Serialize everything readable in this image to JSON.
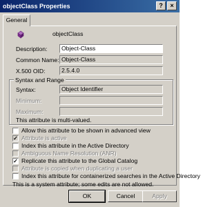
{
  "window": {
    "title": "objectClass Properties",
    "help_button": "?",
    "close_button": "×"
  },
  "tabs": [
    {
      "label": "General"
    }
  ],
  "header": {
    "object_name": "objectClass"
  },
  "fields": {
    "description": {
      "label": "Description:",
      "value": "Object-Class"
    },
    "common_name": {
      "label": "Common Name:",
      "value": "Object-Class"
    },
    "x500_oid": {
      "label": "X.500 OID:",
      "value": "2.5.4.0"
    }
  },
  "syntax_group": {
    "title": "Syntax and Range",
    "syntax": {
      "label": "Syntax:",
      "value": "Object Identifier"
    },
    "minimum": {
      "label": "Minimum:",
      "value": ""
    },
    "maximum": {
      "label": "Maximum:",
      "value": ""
    },
    "note": "This attribute is multi-valued."
  },
  "checkboxes": [
    {
      "label": "Allow this attribute to be shown in advanced view",
      "checked": false,
      "enabled": true
    },
    {
      "label": "Attribute is active",
      "checked": true,
      "enabled": false
    },
    {
      "label": "Index this attribute in the Active Directory",
      "checked": false,
      "enabled": true
    },
    {
      "label": "Ambiguous Name Resolution (ANR)",
      "checked": false,
      "enabled": false
    },
    {
      "label": "Replicate this attribute to the Global Catalog",
      "checked": true,
      "enabled": true
    },
    {
      "label": "Attribute is copied when duplicating a user",
      "checked": false,
      "enabled": false
    },
    {
      "label": "Index this attribute for containerized searches in the Active Directory",
      "checked": false,
      "enabled": true
    }
  ],
  "footer_note": "This is a system attribute; some edits are not allowed.",
  "buttons": {
    "ok": "OK",
    "cancel": "Cancel",
    "apply": "Apply"
  }
}
